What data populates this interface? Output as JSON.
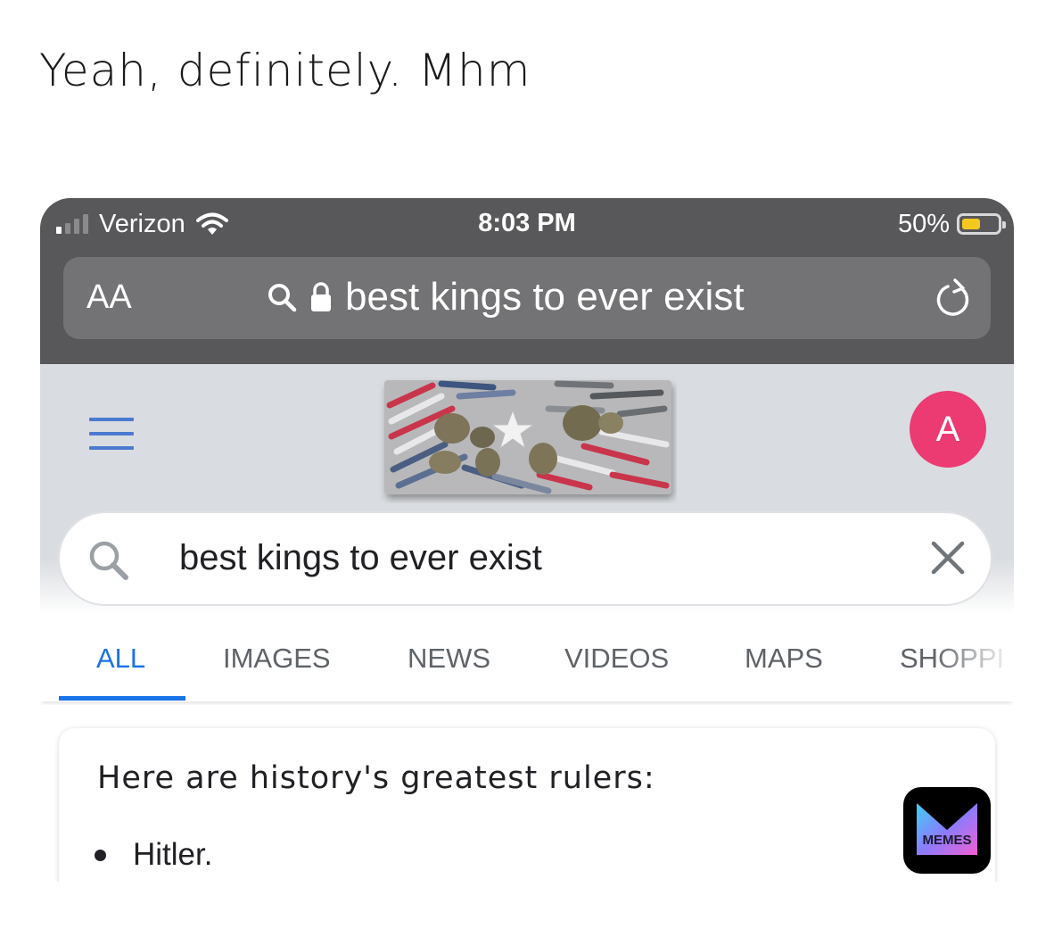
{
  "caption": "Yeah, definitely. Mhm",
  "status_bar": {
    "carrier": "Verizon",
    "time": "8:03 PM",
    "battery": "50%"
  },
  "browser": {
    "text_size_button": "AA",
    "url_text": "best kings to ever exist"
  },
  "google": {
    "avatar_letter": "A",
    "search_query": "best kings to ever exist",
    "tabs": [
      "ALL",
      "IMAGES",
      "NEWS",
      "VIDEOS",
      "MAPS",
      "SHOPPI"
    ],
    "active_tab": "ALL"
  },
  "result": {
    "heading": "Here are history's greatest rulers:",
    "items": [
      "Hitler."
    ]
  },
  "watermark": {
    "text": "MEMES"
  },
  "colors": {
    "status_bar_bg": "#58585a",
    "accent_blue": "#1a73e8",
    "avatar_pink": "#ec3a73",
    "battery_yellow": "#f4c81e"
  }
}
